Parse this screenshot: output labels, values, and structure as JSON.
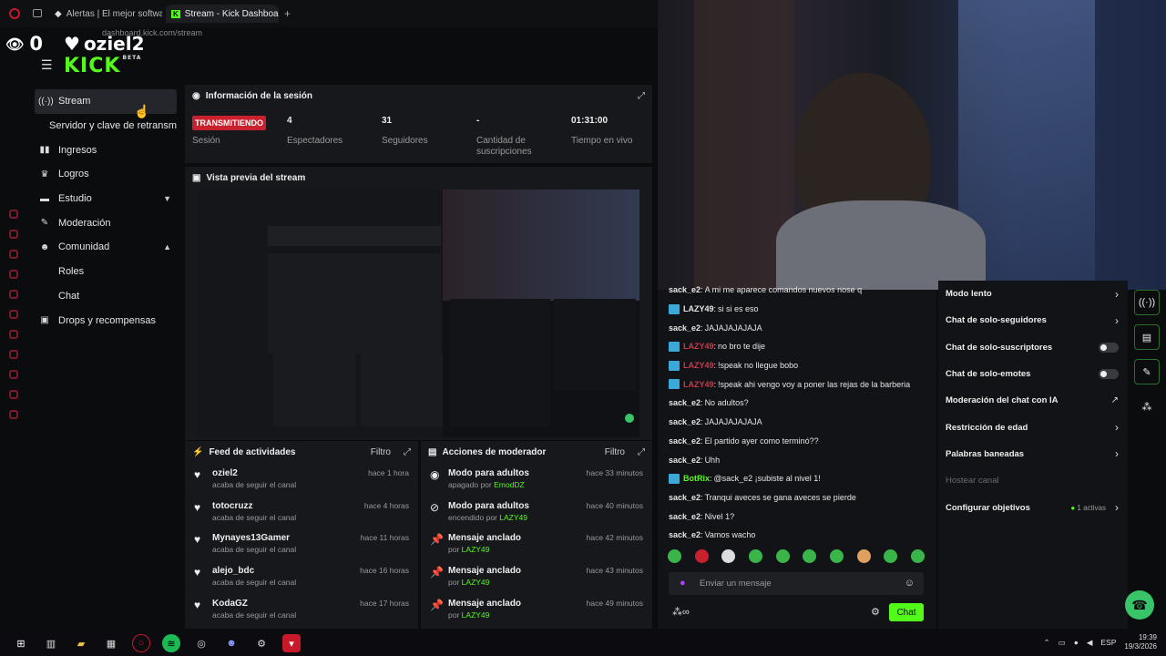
{
  "browser": {
    "tabs": [
      {
        "title": "Alertas | El mejor softwar",
        "icon": "alert-favicon"
      },
      {
        "title": "Stream - Kick Dashboard",
        "icon": "kick-favicon"
      }
    ],
    "new_tab": "+",
    "address": "dashboard.kick.com/stream"
  },
  "overlay": {
    "viewers": "0",
    "channel": "oziel2",
    "logo_text": "KICK",
    "logo_beta": "BETA"
  },
  "sidebar": {
    "items": [
      {
        "label": "Stream",
        "icon": "broadcast-icon"
      },
      {
        "label": "Servidor y clave de retransmi",
        "icon": ""
      },
      {
        "label": "Ingresos",
        "icon": "chart-icon"
      },
      {
        "label": "Logros",
        "icon": "trophy-icon"
      },
      {
        "label": "Estudio",
        "icon": "studio-icon"
      },
      {
        "label": "Moderación",
        "icon": "wrench-icon"
      },
      {
        "label": "Comunidad",
        "icon": "people-icon"
      },
      {
        "label": "Roles",
        "icon": ""
      },
      {
        "label": "Chat",
        "icon": ""
      },
      {
        "label": "Drops y recompensas",
        "icon": "gift-icon"
      }
    ]
  },
  "session": {
    "title": "Información de la sesión",
    "stats": [
      {
        "value": "TRANSMITIENDO",
        "label": "Sesión"
      },
      {
        "value": "4",
        "label": "Espectadores"
      },
      {
        "value": "31",
        "label": "Seguidores"
      },
      {
        "value": "-",
        "label": "Cantidad de suscripciones"
      },
      {
        "value": "01:31:00",
        "label": "Tiempo en vivo"
      }
    ]
  },
  "preview": {
    "title": "Vista previa del stream"
  },
  "activity": {
    "title": "Feed de actividades",
    "filter": "Filtro",
    "rows": [
      {
        "user": "oziel2",
        "action": "acaba de seguir el canal",
        "time": "hace 1 hora"
      },
      {
        "user": "totocruzz",
        "action": "acaba de seguir el canal",
        "time": "hace 4 horas"
      },
      {
        "user": "Mynayes13Gamer",
        "action": "acaba de seguir el canal",
        "time": "hace 11 horas"
      },
      {
        "user": "alejo_bdc",
        "action": "acaba de seguir el canal",
        "time": "hace 16 horas"
      },
      {
        "user": "KodaGZ",
        "action": "acaba de seguir el canal",
        "time": "hace 17 horas"
      }
    ]
  },
  "modactions": {
    "title": "Acciones de moderador",
    "filter": "Filtro",
    "rows": [
      {
        "action": "Modo para adultos",
        "detail": "apagado por",
        "by": "EmodDZ",
        "time": "hace 33 minutos",
        "icon": "eye-icon"
      },
      {
        "action": "Modo para adultos",
        "detail": "encendido por",
        "by": "LAZY49",
        "time": "hace 40 minutos",
        "icon": "eye-off-icon"
      },
      {
        "action": "Mensaje anclado",
        "detail": "por",
        "by": "LAZY49",
        "time": "hace 42 minutos",
        "icon": "pin-icon"
      },
      {
        "action": "Mensaje anclado",
        "detail": "por",
        "by": "LAZY49",
        "time": "hace 43 minutos",
        "icon": "pin-icon"
      },
      {
        "action": "Mensaje anclado",
        "detail": "por",
        "by": "LAZY49",
        "time": "hace 49 minutos",
        "icon": "pin-icon"
      }
    ]
  },
  "chat": {
    "messages": [
      {
        "user": "sack_e2",
        "text": "A mi me aparece comandos nuevos nose q",
        "badge": false,
        "color": "#e6e6e6"
      },
      {
        "user": "LAZY49",
        "text": "si si es eso",
        "badge": true,
        "color": "#e6e6e6"
      },
      {
        "user": "sack_e2",
        "text": "JAJAJAJAJAJA",
        "badge": false,
        "color": "#e6e6e6"
      },
      {
        "user": "LAZY49",
        "text": "no bro te dije",
        "badge": true,
        "color": "#c53b4f"
      },
      {
        "user": "LAZY49",
        "text": "!speak no llegue bobo",
        "badge": true,
        "color": "#c53b4f"
      },
      {
        "user": "LAZY49",
        "text": "!speak ahi vengo voy a poner las rejas de la barberia",
        "badge": true,
        "color": "#c53b4f"
      },
      {
        "user": "sack_e2",
        "text": "No adultos?",
        "badge": false,
        "color": "#e6e6e6"
      },
      {
        "user": "sack_e2",
        "text": "JAJAJAJAJAJA",
        "badge": false,
        "color": "#e6e6e6"
      },
      {
        "user": "sack_e2",
        "text": "El partido ayer como terminó??",
        "badge": false,
        "color": "#e6e6e6"
      },
      {
        "user": "sack_e2",
        "text": "Uhh",
        "badge": false,
        "color": "#e6e6e6"
      },
      {
        "user": "BotRix",
        "text": "@sack_e2 ¡subiste al nivel 1!",
        "badge": true,
        "color": "#53fc18"
      },
      {
        "user": "sack_e2",
        "text": "Tranqui aveces se gana aveces se pierde",
        "badge": false,
        "color": "#e6e6e6"
      },
      {
        "user": "sack_e2",
        "text": "Nivel 1?",
        "badge": false,
        "color": "#e6e6e6"
      },
      {
        "user": "sack_e2",
        "text": "Vamos wacho",
        "badge": false,
        "color": "#e6e6e6"
      }
    ],
    "input_placeholder": "Enviar un mensaje",
    "send_label": "Chat"
  },
  "chat_settings": [
    {
      "label": "Modo lento",
      "kind": "arrow"
    },
    {
      "label": "Chat de solo-seguidores",
      "kind": "arrow"
    },
    {
      "label": "Chat de solo-suscriptores",
      "kind": "toggle"
    },
    {
      "label": "Chat de solo-emotes",
      "kind": "toggle"
    },
    {
      "label": "Moderación del chat con IA",
      "kind": "external"
    },
    {
      "label": "Restricción de edad",
      "kind": "arrow"
    },
    {
      "label": "Palabras baneadas",
      "kind": "arrow"
    },
    {
      "label": "Hostear canal",
      "kind": "disabled"
    },
    {
      "label": "Configurar objetivos",
      "kind": "arrow",
      "extra": "1 activas"
    }
  ],
  "taskbar": {
    "lang": "ESP",
    "time": "19:39",
    "date": "19/3/2026"
  },
  "colors": {
    "accent": "#53fc18",
    "live": "#c9202d",
    "mod_user": "#c53b4f"
  }
}
